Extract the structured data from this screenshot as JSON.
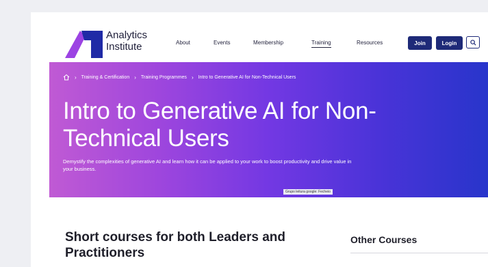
{
  "brand": {
    "name_line1": "Analytics",
    "name_line2": "Institute",
    "colors": {
      "primary": "#1e2a78",
      "gradient_start": "#c05ad4",
      "gradient_end": "#2835cb"
    }
  },
  "nav": {
    "items": [
      {
        "label": "About"
      },
      {
        "label": "Events"
      },
      {
        "label": "Membership"
      },
      {
        "label": "Training",
        "active": true
      },
      {
        "label": "Resources"
      }
    ],
    "join_label": "Join",
    "login_label": "Login",
    "search_icon": "search-icon"
  },
  "breadcrumb": {
    "home_icon": "home-icon",
    "items": [
      "Training & Certification",
      "Training Programmes",
      "Intro to Generative AI for Non-Technical Users"
    ]
  },
  "hero": {
    "title": "Intro to Generative AI for Non-Technical Users",
    "description": "Demystify the complexities of generative AI and learn how it can be applied to your work to boost productivity and drive value in your business.",
    "photo_credit": "Grupo leitura google: Fecheio"
  },
  "content": {
    "section_title": "Short courses for both Leaders and Practitioners",
    "sidebar_title": "Other Courses"
  }
}
